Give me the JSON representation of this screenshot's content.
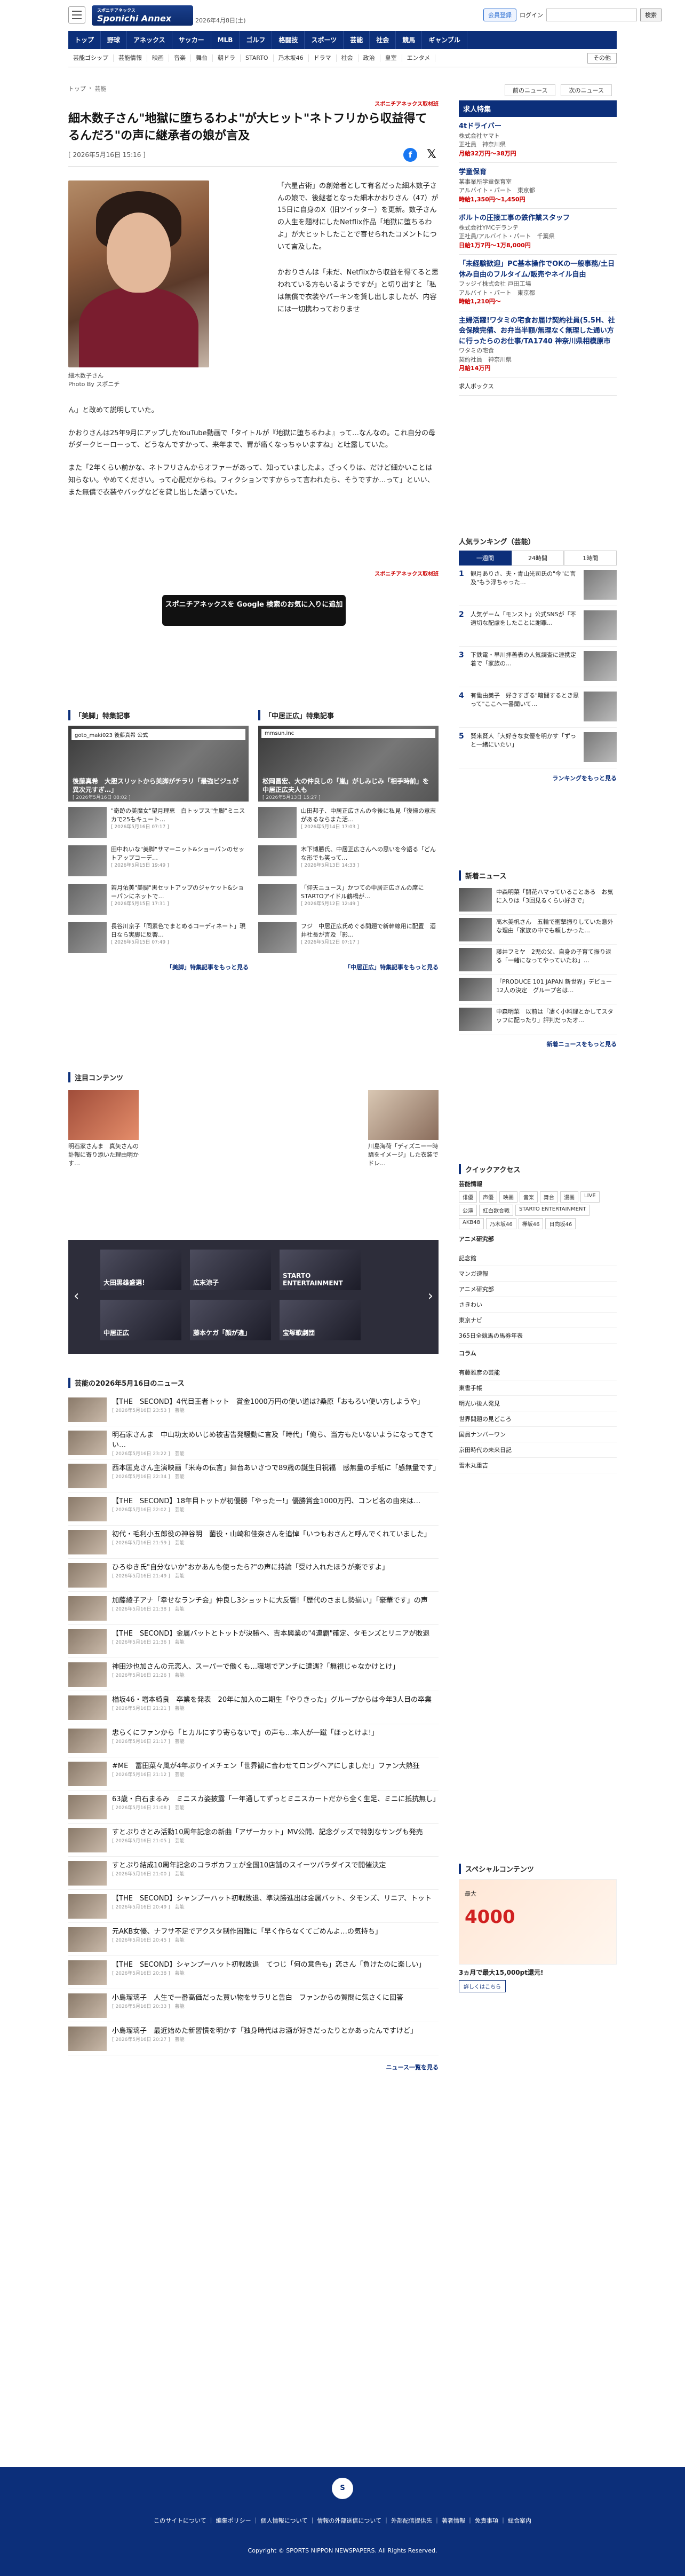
{
  "header": {
    "logo": "Sponichi Annex",
    "logo_sub": "スポニチアネックス",
    "date": "2026年4月8日(土)",
    "member_btn": "会員登録",
    "login": "ログイン",
    "search_btn": "検索"
  },
  "gnav": [
    "トップ",
    "野球",
    "アネックス",
    "サッカー",
    "MLB",
    "ゴルフ",
    "格闘技",
    "スポーツ",
    "芸能",
    "社会",
    "競馬",
    "ギャンブル"
  ],
  "snav": [
    "芸能ゴシップ",
    "芸能情報",
    "映画",
    "音楽",
    "舞台",
    "朝ドラ",
    "STARTO",
    "乃木坂46",
    "ドラマ",
    "社会",
    "政治",
    "皇室",
    "エンタメ",
    "その他"
  ],
  "breadcrumb": [
    "トップ",
    "芸能"
  ],
  "nav_prev": "前のニュース",
  "nav_next": "次のニュース",
  "article": {
    "source": "スポニチアネックス取材班",
    "title": "細木数子さん\"地獄に堕ちるわよ\"が大ヒット\"ネトフリから収益得てるんだろ\"の声に継承者の娘が言及",
    "date": "[ 2026年5月16日 15:16 ]",
    "photo_caption": "細木数子さん",
    "photo_credit": "Photo By スポニチ",
    "p1": "「六星占術」の創始者として有名だった細木数子さんの娘で、後継者となった細木かおりさん（47）が15日に自身のX（旧ツイッター）を更新。数子さんの人生を題材にしたNetflix作品「地獄に堕ちるわよ」が大ヒットしたことで寄せられたコメントについて言及した。",
    "p2": "かおりさんは「未だ、Netflixから収益を得てると思われている方もいるようですが」と切り出すと「私は無償で衣装やパーキンを貸し出しましたが、内容には一切携わっておりませ",
    "p2b": "ん」と改めて説明していた。",
    "p3": "かおりさんは25年9月にアップしたYouTube動画で「タイトルが『地獄に堕ちるわよ』って…なんなの。これ自分の母がダークヒーローって、どうなんですかって、来年まで、胃が痛くなっちゃいますね」と吐露していた。",
    "p4": "また「2年くらい前かな、ネトフリさんからオファーがあって、知っていましたよ。ざっくりは、だけど細かいことは知らない。やめてください。って心配だからね。フィクションですからって言われたら、そうですか…って」といい、また無償で衣装やバッグなどを貸し出した語っていた。",
    "source2": "スポニチアネックス取材班",
    "google_btn": "スポニチアネックスを Google 検索のお気に入りに追加"
  },
  "feature_left": {
    "heading": "「美脚」特集記事",
    "account": "goto_maki023 後藤真希 公式",
    "hero_caption": "後藤真希　大胆スリットから美脚がチラリ「最強ビジュが異次元すぎ…」",
    "hero_date": "[ 2026年5月16日 08:02 ]",
    "rows": [
      {
        "text": "\"奇跡の美魔女\"望月理恵　白トップス\"生脚\"ミニスカで25もキュート…",
        "date": "[ 2026年5月16日 07:17 ]"
      },
      {
        "text": "田中れいな\"美脚\"サマーニット&ショーパンのセットアップコーデ…",
        "date": "[ 2026年5月15日 19:49 ]"
      },
      {
        "text": "若月佑美\"美脚\"黒セットアップのジャケット&ショーパンにネットで…",
        "date": "[ 2026年5月15日 17:31 ]"
      },
      {
        "text": "長谷川京子「同素色でまとめるコーディネート」現日なら実脚に反響…",
        "date": "[ 2026年5月15日 07:49 ]"
      }
    ],
    "more": "「美脚」特集記事をもっと見る"
  },
  "feature_right": {
    "heading": "「中居正広」特集記事",
    "account": "mmsun.inc",
    "hero_caption": "松岡昌宏、大の仲良しの「嵐」がしみじみ「相手時前」を中居正広夫人も",
    "hero_date": "[ 2026年5月13日 15:27 ]",
    "rows": [
      {
        "text": "山田邦子、中居正広さんの今後に私見「復帰の意志があるならまた活…",
        "date": "[ 2026年5月14日 17:03 ]"
      },
      {
        "text": "木下博勝氏、中居正広さんへの思いを今語る「どんな形でも笑って…",
        "date": "[ 2026年5月13日 14:33 ]"
      },
      {
        "text": "「仰天ニュース」かつての中居正広さんの席にSTARTOアイドル鶴橋が…",
        "date": "[ 2026年5月12日 12:49 ]"
      },
      {
        "text": "フジ　中居正広氏めぐる問題で新幹線用に配置　酒井社長が言及「影…",
        "date": "[ 2026年5月12日 07:17 ]"
      }
    ],
    "more": "「中居正広」特集記事をもっと見る"
  },
  "attention": {
    "heading": "注目コンテンツ",
    "left": "明石家さんま　真矢さんの訃報に寄り添いた理由明かす…",
    "right": "川島海荷「ディズニー一時騒をイメージ」した衣装でドレ…"
  },
  "carousel": [
    "大田黒雄盛選！",
    "広末涼子",
    "STARTO ENTERTAINMENT",
    "中居正広",
    "藤本ケガ「顔が違」",
    "宝塚歌劇団"
  ],
  "newslist": {
    "heading": "芸能の2026年5月16日のニュース",
    "items": [
      {
        "text": "【THE　SECOND】4代目王者トット　賞金1000万円の使い道は?桑原「おもろい使い方しようや」",
        "date": "[ 2026年5月16日 23:53 ]　芸能"
      },
      {
        "text": "明石家さんま　中山功太めいじめ被害告発騒動に言及「時代」「俺ら、当方もたいないようになってきてい…",
        "date": "[ 2026年5月16日 23:22 ]　芸能"
      },
      {
        "text": "西本匡克さん主演映画「米寿の伝言」舞台あいさつで89歳の誕生日祝福　感無量の手紙に「感無量です」",
        "date": "[ 2026年5月16日 22:34 ]　芸能"
      },
      {
        "text": "【THE　SECOND】18年目トットが初優勝「やったー!」優勝賞金1000万円、コンビ名の由来は…",
        "date": "[ 2026年5月16日 22:02 ]　芸能"
      },
      {
        "text": "初代・毛利小五郎役の神谷明　菌役・山崎和佳奈さんを追悼「いつもおさんと呼んでくれていました」",
        "date": "[ 2026年5月16日 21:59 ]　芸能"
      },
      {
        "text": "ひろゆき氏\"自分ないか\"おかあんも使ったら?\"の声に持論「受け入れたほうが楽ですよ」",
        "date": "[ 2026年5月16日 21:49 ]　芸能"
      },
      {
        "text": "加藤綾子アナ「幸せなランチ会」仲良し3ショットに大反響!「歴代のさまし勢揃い」「豪華です」の声",
        "date": "[ 2026年5月16日 21:38 ]　芸能"
      },
      {
        "text": "【THE　SECOND】金属バットとトットが決勝へ、吉本興業の\"4連覇\"確定、タモンズとリニアが敗退",
        "date": "[ 2026年5月16日 21:36 ]　芸能"
      },
      {
        "text": "神田沙也加さんの元恋人、スーパーで働くも…職場でアンチに遭遇?「無視じゃなかけとけ」",
        "date": "[ 2026年5月16日 21:26 ]　芸能"
      },
      {
        "text": "楢坂46・増本綺良　卒業を発表　20年に加入の二期生「やりきった」グループからは今年3人目の卒業",
        "date": "[ 2026年5月16日 21:21 ]　芸能"
      },
      {
        "text": "忠らくにファンから「ヒカルにすり寄らないで」の声も…本人が一蹴「ほっとけよ!」",
        "date": "[ 2026年5月16日 21:17 ]　芸能"
      },
      {
        "text": "#ME　冨田菜々風が4年ぶりイメチェン「世界観に合わせてロングヘアにしました!」ファン大熱狂",
        "date": "[ 2026年5月16日 21:12 ]　芸能"
      },
      {
        "text": "63歳・白石まるみ　ミニスカ姿披露「一年通してずっとミニスカートだから全く生足、ミニに抵抗無し」",
        "date": "[ 2026年5月16日 21:08 ]　芸能"
      },
      {
        "text": "すとぷりさとみ活動10周年記念の新曲「アザーカット」MV公開、記念グッズで特別なサングも発売",
        "date": "[ 2026年5月16日 21:05 ]　芸能"
      },
      {
        "text": "すとぷり結成10周年記念のコラボカフェが全国10店舗のスイーツパラダイスで開催決定",
        "date": "[ 2026年5月16日 21:00 ]　芸能"
      },
      {
        "text": "【THE　SECOND】シャンプーハット初戦敗退、準決勝進出は金属バット、タモンズ、リニア、トット",
        "date": "[ 2026年5月16日 20:49 ]　芸能"
      },
      {
        "text": "元AKB女優、ナフサ不足でアクスタ制作困難に「早く作らなくてごめんよ…の気持ち」",
        "date": "[ 2026年5月16日 20:45 ]　芸能"
      },
      {
        "text": "【THE　SECOND】シャンプーハット初戦敗退　てつじ「何の意色も」恋さん「負けたのに楽しい」",
        "date": "[ 2026年5月16日 20:38 ]　芸能"
      },
      {
        "text": "小島瑠璃子　人生で一番高価だった買い物をサラリと告白　ファンからの質問に気さくに回答",
        "date": "[ 2026年5月16日 20:33 ]　芸能"
      },
      {
        "text": "小島瑠璃子　最近始めた新習慣を明かす「独身時代はお酒が好きだったりとかあったんですけど」",
        "date": "[ 2026年5月16日 20:27 ]　芸能"
      }
    ],
    "more": "ニュース一覧を見る"
  },
  "jobs": {
    "heading": "求人特集",
    "items": [
      {
        "title": "4tドライバー",
        "co": "株式会社ヤマト",
        "type": "正社員",
        "loc": "神奈川県",
        "pay": "月給32万円〜38万円"
      },
      {
        "title": "学童保育",
        "co": "某事業所学童保育室",
        "type": "アルバイト・パート",
        "loc": "東京都",
        "pay": "時給1,350円〜1,450円"
      },
      {
        "title": "ボルトの圧接工事の鉄作業スタッフ",
        "co": "株式会社YMCデランテ",
        "type": "正社員/アルバイト・パート",
        "loc": "千葉県",
        "pay": "日給1万7円〜1万8,000円"
      },
      {
        "title": "「未経験歓迎」PC基本操作でOKの一般事務/土日休み自由のフルタイム/販売やネイル自由",
        "co": "フッジイ株式会社 戸田工場",
        "type": "アルバイト・パート",
        "loc": "東京都",
        "pay": "時給1,210円〜"
      },
      {
        "title": "主婦活躍!ワタミの宅食お届け契約社員(5.5H、社会保険完備、お弁当半額/無理なく無理した通い方に行ったらのお仕事/TA1740 神奈川県相模原市",
        "co": "ワタミの宅食",
        "type": "契約社員",
        "loc": "神奈川県",
        "pay": "月給14万円"
      }
    ],
    "ad": "求人ボックス"
  },
  "ranking": {
    "heading": "人気ランキング（芸能）",
    "tabs": [
      "一週間",
      "24時間",
      "1時間"
    ],
    "items": [
      {
        "n": "1",
        "text": "観月ありさ、夫・青山光司氏の\"今\"に言及\"もう浮ちゃった…"
      },
      {
        "n": "2",
        "text": "人気ゲーム「モンスト」公式SNSが「不適切な配慮をしたことに謝罪…"
      },
      {
        "n": "3",
        "text": "下鉄電・早川拝善表の人気調査に連携定着で「家族の…"
      },
      {
        "n": "4",
        "text": "有働由美子　好きすぎる\"暗闘するとき思って\"ここへ一番聞いて…"
      },
      {
        "n": "5",
        "text": "賢来賢人「大好きな女優を明かす「ずっと一緒にいたい」"
      }
    ],
    "more": "ランキングをもっと見る"
  },
  "latest": {
    "heading": "新着ニュース",
    "items": [
      {
        "text": "中森明菜「開花ハマっていることある　お気に入りは「3回見るくらい好きで」"
      },
      {
        "text": "高木美帆さん　五輪で衝撃振りしていた意外な理由「家族の中でも頼しかった…"
      },
      {
        "text": "藤井フミヤ　2児の父、自身の子育て振り返る「一緒になってやっていたね」…"
      },
      {
        "text": "「PRODUCE 101 JAPAN 新世界」デビュー12人の決定　グループ名は…"
      },
      {
        "text": "中森明菜　以前は「凄く小料理とかしてスタッフに配ったり」評判だったオ…"
      }
    ],
    "more": "新着ニュースをもっと見る"
  },
  "quick": {
    "heading": "クイックアクセス",
    "sub1": "芸能情報",
    "tags1": [
      "俳優",
      "声優",
      "映画",
      "音楽",
      "舞台",
      "漫画",
      "LIVE",
      "公演",
      "紅白歌合戦",
      "STARTO ENTERTAINMENT",
      "AKB48",
      "乃木坂46",
      "欅坂46",
      "日向坂46"
    ],
    "coll_heading": "アニメ研究部",
    "coll": [
      "記念館",
      "マンガ速報",
      "アニメ研究部",
      "さきわい",
      "東京ナビ",
      "365日全競馬の馬券年表"
    ],
    "column_heading": "コラム",
    "columns": [
      "有藤雅彦の芸能",
      "東書手帳",
      "明光い後人発見",
      "世界問題の見どころ",
      "国員ナンバーワン",
      "京田時代の未来日記",
      "雪木丸重吉"
    ]
  },
  "special": {
    "heading": "スペシャルコンテンツ",
    "ad_small": "最大",
    "ad_big": "4000",
    "caption": "3ヵ月で最大15,000pt還元!",
    "btn": "詳しくはこちら"
  },
  "footer": {
    "logo": "S",
    "links": "このサイトについて ｜ 編集ポリシー ｜ 個人情報について ｜ 情報の外部送信について ｜ 外部配信提供先 ｜ 著者情報 ｜ 免責事項 ｜ 総合案内",
    "copyright": "Copyright © SPORTS NIPPON NEWSPAPERS. All Rights Reserved."
  }
}
